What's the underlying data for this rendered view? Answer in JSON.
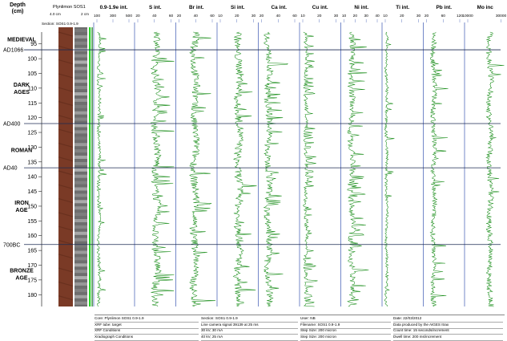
{
  "chart_data": {
    "type": "line",
    "header": {
      "depth_label": "Depth",
      "depth_unit": "(cm)",
      "core_name": "Plynlimon SOS1",
      "core_section": "Section: SOS1 0.9-1.9",
      "core_scale": "4.0 cm",
      "xray_scale": "2 cm",
      "first_log_label": "0.9-1.9e int."
    },
    "ylim": [
      91,
      184
    ],
    "depth_ticks": [
      95,
      100,
      105,
      110,
      115,
      120,
      125,
      130,
      135,
      140,
      145,
      150,
      155,
      160,
      165,
      170,
      175,
      180
    ],
    "boundaries": [
      {
        "label": "AD1066",
        "depth": 97
      },
      {
        "label": "AD400",
        "depth": 122
      },
      {
        "label": "AD40",
        "depth": 137
      },
      {
        "label": "700BC",
        "depth": 163
      }
    ],
    "periods": [
      {
        "lines": [
          "MEDIEVAL"
        ],
        "depth": 93.5
      },
      {
        "lines": [
          "DARK",
          "AGES"
        ],
        "depth": 110
      },
      {
        "lines": [
          "ROMAN"
        ],
        "depth": 131
      },
      {
        "lines": [
          "IRON",
          "AGE"
        ],
        "depth": 150
      },
      {
        "lines": [
          "BRONZE",
          "AGE"
        ],
        "depth": 173
      }
    ],
    "tracks": [
      {
        "name": "S int.",
        "ticks": [
          "20",
          "40",
          "60"
        ],
        "xlim": [
          0,
          80
        ],
        "base": 42,
        "amp": 8,
        "spike": 0.05
      },
      {
        "name": "Br int.",
        "ticks": [
          "20",
          "40",
          "60"
        ],
        "xlim": [
          0,
          70
        ],
        "base": 32,
        "amp": 7,
        "spike": 0.04
      },
      {
        "name": "Si int.",
        "ticks": [
          "10",
          "20",
          "30"
        ],
        "xlim": [
          0,
          40
        ],
        "base": 21,
        "amp": 4,
        "spike": 0.04
      },
      {
        "name": "Ca int.",
        "ticks": [
          "20",
          "40",
          "60"
        ],
        "xlim": [
          0,
          80
        ],
        "base": 18,
        "amp": 7,
        "spike": 0.09
      },
      {
        "name": "Cu int.",
        "ticks": [
          "10",
          "20",
          "30"
        ],
        "xlim": [
          0,
          40
        ],
        "base": 5,
        "amp": 2,
        "spike": 0.16
      },
      {
        "name": "Ni int.",
        "ticks": [
          "10",
          "20",
          "30",
          "40"
        ],
        "xlim": [
          0,
          50
        ],
        "base": 12,
        "amp": 4,
        "spike": 0.14
      },
      {
        "name": "Ti int.",
        "ticks": [
          "10",
          "20",
          "30"
        ],
        "xlim": [
          0,
          40
        ],
        "base": 3,
        "amp": 1.5,
        "spike": 0.05
      },
      {
        "name": "Pb int.",
        "ticks": [
          "20",
          "60",
          "120"
        ],
        "xlim": [
          0,
          150
        ],
        "base": 35,
        "amp": 10,
        "spike": 0.06
      },
      {
        "name": "Mo inc",
        "ticks": [
          "10000",
          "30000"
        ],
        "xlim": [
          0,
          40000
        ],
        "base": 25000,
        "amp": 3000,
        "spike": 0.02
      }
    ],
    "log_track": {
      "name": "0.9-1.9e int.",
      "ticks": [
        "100",
        "300",
        "500"
      ],
      "xlim": [
        0,
        600
      ],
      "base": 60,
      "amp": 25,
      "spike": 0.06
    },
    "colors": {
      "trace": "#138a13",
      "boundary": "#1b2a50",
      "axis": "#3a55b0",
      "core": "#7a3a26",
      "bright": "#27d827"
    }
  },
  "footer": [
    [
      "Core: Plynlimon SOS1 0.9-1.9",
      "Section: SOS1 0.9-1.9",
      "User: NB",
      "Date: 22/03/2012"
    ],
    [
      "XRF tube: target",
      "Line camera signal 39139 at 25 ms",
      "Filename: SOS1 0.9-1.9",
      "Data produced by the AIGES Itrax"
    ],
    [
      "XRF Conditions",
      "30 kV, 30 mA",
      "Step Size: 200 micron",
      "Count time: 15 seconds/increment"
    ],
    [
      "Xradiograph Conditions",
      "40 kV, 25 mA",
      "Step Size: 200 micron",
      "Dwell time: 200 ms/increment"
    ]
  ]
}
